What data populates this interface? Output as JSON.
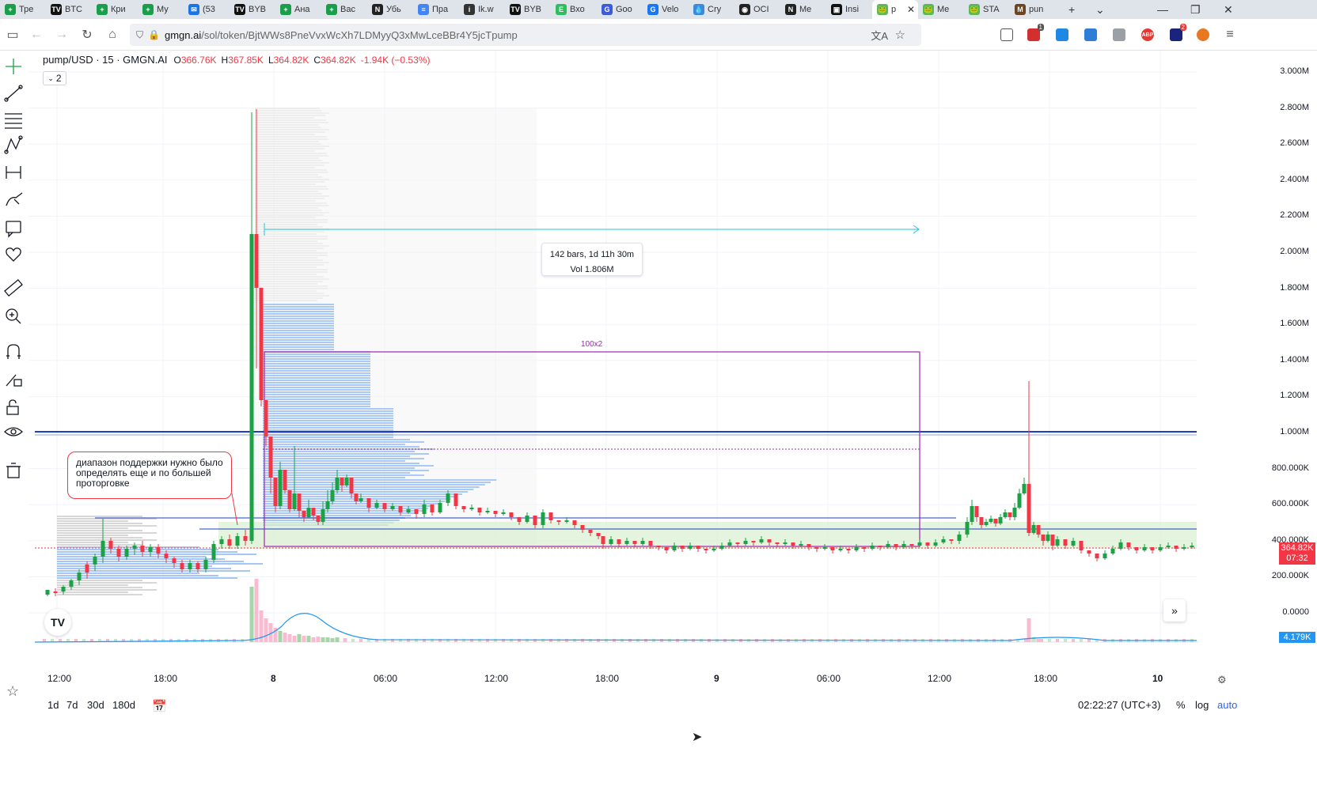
{
  "browser": {
    "tabs": [
      {
        "label": "Тре",
        "color": "#1a9e4b",
        "glyph": "+"
      },
      {
        "label": "BTC",
        "color": "#111111",
        "glyph": "TV"
      },
      {
        "label": "Кри",
        "color": "#1a9e4b",
        "glyph": "+"
      },
      {
        "label": "Му",
        "color": "#1a9e4b",
        "glyph": "+"
      },
      {
        "label": "(53",
        "color": "#1a73e8",
        "glyph": "✉"
      },
      {
        "label": "BYB",
        "color": "#111111",
        "glyph": "TV"
      },
      {
        "label": "Ана",
        "color": "#1a9e4b",
        "glyph": "+"
      },
      {
        "label": "Вас",
        "color": "#1a9e4b",
        "glyph": "+"
      },
      {
        "label": "Убь",
        "color": "#222222",
        "glyph": "N"
      },
      {
        "label": "Пра",
        "color": "#4285f4",
        "glyph": "≡"
      },
      {
        "label": "Ik.w",
        "color": "#333333",
        "glyph": "i"
      },
      {
        "label": "BYB",
        "color": "#111111",
        "glyph": "TV"
      },
      {
        "label": "Вхо",
        "color": "#2dbe60",
        "glyph": "E"
      },
      {
        "label": "Goo",
        "color": "#3b5bdb",
        "glyph": "G"
      },
      {
        "label": "Velo",
        "color": "#1877f2",
        "glyph": "G"
      },
      {
        "label": "Cry",
        "color": "#3a8bd8",
        "glyph": "💧"
      },
      {
        "label": "OCI",
        "color": "#222222",
        "glyph": "◉"
      },
      {
        "label": "Me",
        "color": "#222222",
        "glyph": "N"
      },
      {
        "label": "Insi",
        "color": "#111111",
        "glyph": "▣"
      },
      {
        "label": "p",
        "color": "#5cb85c",
        "glyph": "🐸",
        "active": true
      },
      {
        "label": "Me",
        "color": "#5cb85c",
        "glyph": "🐸"
      },
      {
        "label": "STA",
        "color": "#5cb85c",
        "glyph": "🐸"
      },
      {
        "label": "pun",
        "color": "#6b4423",
        "glyph": "M"
      }
    ],
    "url_host": "gmgn.ai",
    "url_path": "/sol/token/BjtWWs8PneVvxWcXh7LDMyyQ3xMwLceBBr4Y5jcTpump",
    "ext_badge_1": "1",
    "ext_badge_2": "2"
  },
  "chart": {
    "symbol": "pump/USD · 15 · GMGN.AI",
    "ohlc": {
      "o_label": "O",
      "o": "366.76K",
      "h_label": "H",
      "h": "367.85K",
      "l_label": "L",
      "l": "364.82K",
      "c_label": "C",
      "c": "364.82K",
      "change": "-1.94K (−0.53%)"
    },
    "indicators_count": "2",
    "y_ticks": [
      "3.000M",
      "2.800M",
      "2.600M",
      "2.400M",
      "2.200M",
      "2.000M",
      "1.800M",
      "1.600M",
      "1.400M",
      "1.200M",
      "1.000M",
      "800.000K",
      "600.000K",
      "400.000K",
      "200.000K",
      "0.0000"
    ],
    "price_tag": "364.82K",
    "countdown": "07:32",
    "volume_tag": "4.179K",
    "x_ticks": [
      "12:00",
      "18:00",
      "8",
      "06:00",
      "12:00",
      "18:00",
      "9",
      "06:00",
      "12:00",
      "18:00",
      "10"
    ],
    "annotation": "диапазон поддержки нужно было определять еще и по большей проторговке",
    "measure_line1": "142 bars, 1d 11h 30m",
    "measure_line2": "Vol 1.806M",
    "rect_label": "100x2",
    "colors": {
      "up": "#26a69a",
      "up_bright": "#1aa245",
      "down": "#f23645",
      "level": "#1e40c0",
      "profile": "#6aa2ef",
      "rect": "#9c27b0",
      "zone": "#d8f0d0",
      "measure": "#26c6da"
    }
  },
  "bottom": {
    "ranges": [
      "1d",
      "7d",
      "30d",
      "180d"
    ],
    "time": "02:22:27 (UTC+3)",
    "pct": "%",
    "log": "log",
    "auto": "auto"
  }
}
